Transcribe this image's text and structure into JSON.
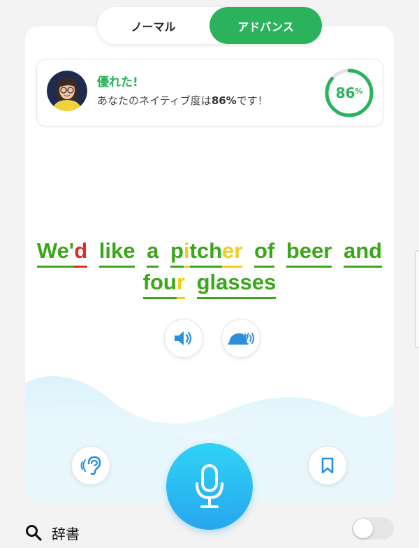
{
  "tabs": [
    {
      "label": "ノーマル",
      "active": false
    },
    {
      "label": "アドバンス",
      "active": true
    }
  ],
  "result": {
    "title": "優れた!",
    "message_prefix": "あなたのネイティブ度は",
    "score_text": "86%",
    "message_suffix": "です！",
    "score_value": 86,
    "score_label": "86",
    "score_unit": "%"
  },
  "sentence": {
    "line1": [
      {
        "segments": [
          {
            "t": "We'",
            "c": "g"
          },
          {
            "t": "d",
            "c": "r"
          }
        ]
      },
      {
        "segments": [
          {
            "t": "like",
            "c": "g"
          }
        ]
      },
      {
        "segments": [
          {
            "t": "a",
            "c": "g"
          }
        ]
      },
      {
        "segments": [
          {
            "t": "p",
            "c": "g"
          },
          {
            "t": "i",
            "c": "y"
          },
          {
            "t": "tch",
            "c": "g"
          },
          {
            "t": "er",
            "c": "y"
          }
        ]
      },
      {
        "segments": [
          {
            "t": "of",
            "c": "g"
          }
        ]
      },
      {
        "segments": [
          {
            "t": "beer",
            "c": "g"
          }
        ]
      },
      {
        "segments": [
          {
            "t": "and",
            "c": "g"
          }
        ]
      }
    ],
    "line2": [
      {
        "segments": [
          {
            "t": "fou",
            "c": "g"
          },
          {
            "t": "r",
            "c": "y"
          }
        ]
      },
      {
        "segments": [
          {
            "t": "glasses",
            "c": "g"
          }
        ]
      }
    ]
  },
  "icons": {
    "play": "speaker-icon",
    "slow": "snail-icon",
    "listen": "ear-icon",
    "bookmark": "bookmark-icon",
    "mic": "microphone-icon",
    "search": "search-icon"
  },
  "footer": {
    "dictionary_label": "辞書",
    "toggle_on": false
  },
  "colors": {
    "accent_green": "#2ab35c",
    "text_green": "#3aa61a",
    "error_red": "#e02b2b",
    "warn_yellow": "#f1cf16",
    "mic_blue": "#28a6ee"
  }
}
